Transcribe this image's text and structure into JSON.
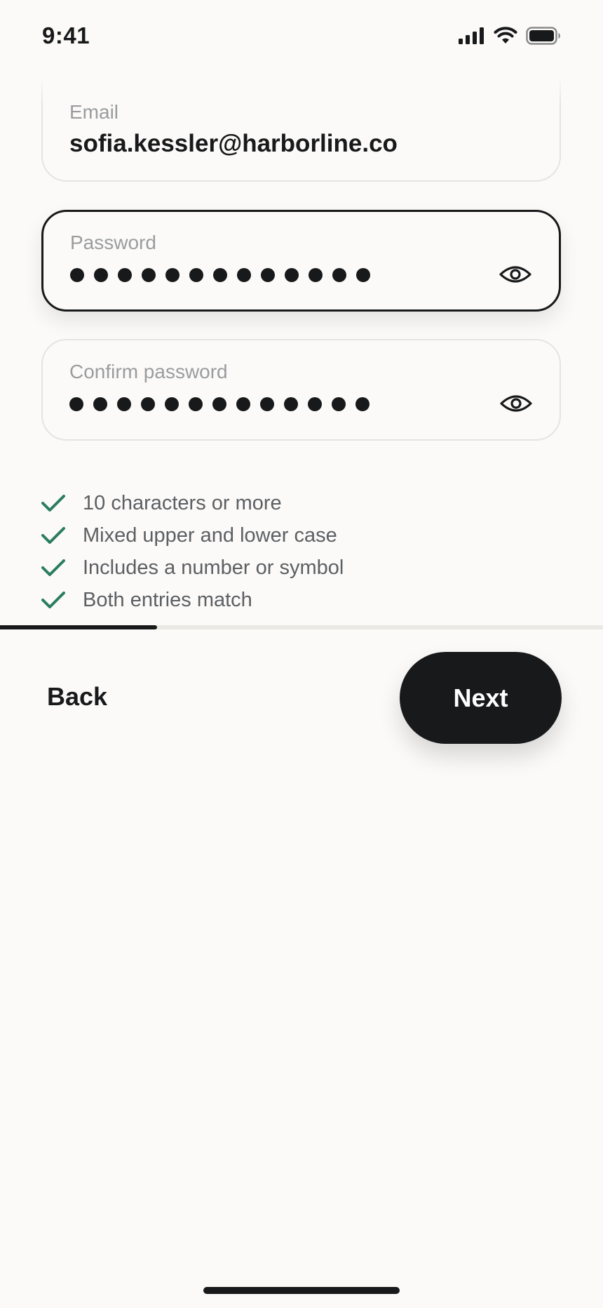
{
  "status_bar": {
    "time": "9:41",
    "icons": [
      "cellular-signal-icon",
      "wifi-icon",
      "battery-icon"
    ]
  },
  "form": {
    "email": {
      "label": "Email",
      "value": "sofia.kessler@harborline.co"
    },
    "password": {
      "label": "Password",
      "masked_length": 13,
      "toggle_icon": "eye-icon",
      "focused": true
    },
    "confirm_password": {
      "label": "Confirm password",
      "masked_length": 13,
      "toggle_icon": "eye-icon"
    }
  },
  "requirements": [
    {
      "text": "10 characters or more",
      "met": true
    },
    {
      "text": "Mixed upper and lower case",
      "met": true
    },
    {
      "text": "Includes a number or symbol",
      "met": true
    },
    {
      "text": "Both entries match",
      "met": true
    }
  ],
  "progress": {
    "fraction": 0.26
  },
  "footer": {
    "back_label": "Back",
    "next_label": "Next"
  },
  "colors": {
    "background": "#fbfaf8",
    "text": "#18191b",
    "check": "#2a7d5e",
    "muted": "#9a9c9f"
  }
}
